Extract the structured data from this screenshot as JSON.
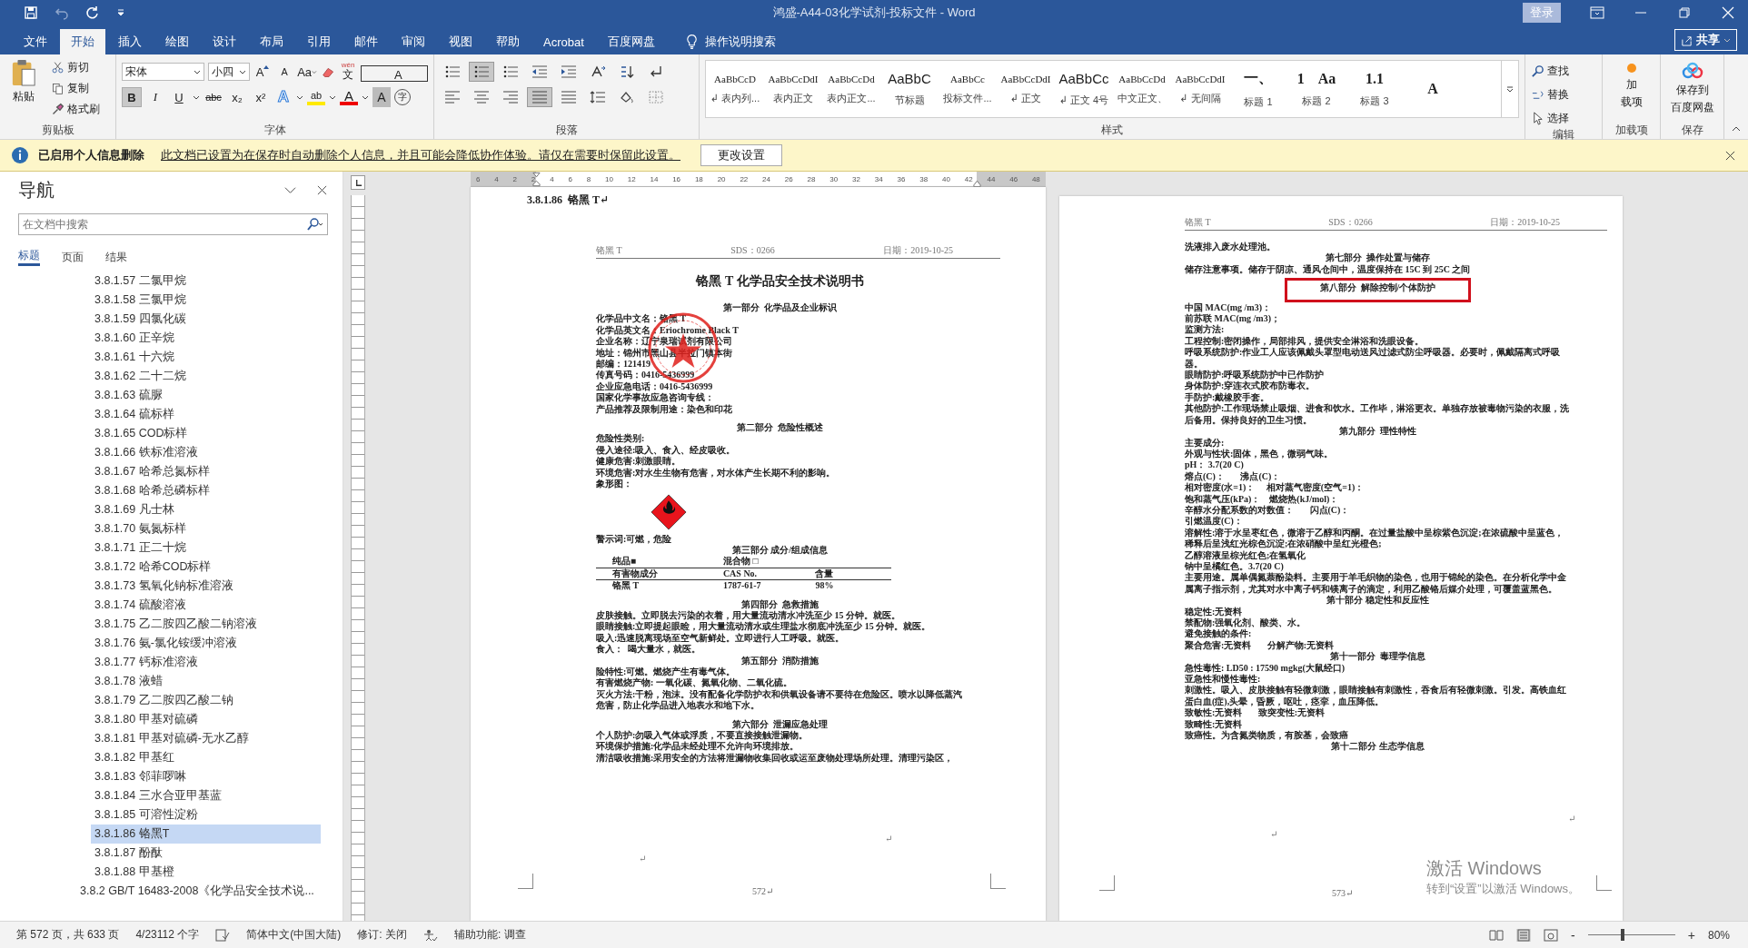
{
  "window": {
    "title": "鸿盛-A44-03化学试剂-投标文件  -  Word",
    "sign_in": "登录"
  },
  "tabs": [
    {
      "label": "文件",
      "selected": false
    },
    {
      "label": "开始",
      "selected": true
    },
    {
      "label": "插入",
      "selected": false
    },
    {
      "label": "绘图",
      "selected": false
    },
    {
      "label": "设计",
      "selected": false
    },
    {
      "label": "布局",
      "selected": false
    },
    {
      "label": "引用",
      "selected": false
    },
    {
      "label": "邮件",
      "selected": false
    },
    {
      "label": "审阅",
      "selected": false
    },
    {
      "label": "视图",
      "selected": false
    },
    {
      "label": "帮助",
      "selected": false
    },
    {
      "label": "Acrobat",
      "selected": false
    },
    {
      "label": "百度网盘",
      "selected": false
    }
  ],
  "tell_me": "操作说明搜索",
  "share": "共享",
  "ribbon": {
    "clipboard": {
      "paste": "粘贴",
      "items": [
        "剪切",
        "复制",
        "格式刷"
      ],
      "label": "剪贴板"
    },
    "font": {
      "name": "宋体",
      "size": "小四",
      "grow": "A",
      "shrink": "A",
      "case": "Aa",
      "ruby": "wén",
      "ruby_base": "文",
      "border_char": "A",
      "row2": [
        {
          "text": "B",
          "selected": true
        },
        {
          "text": "I",
          "selected": false
        },
        {
          "text": "U",
          "selected": false
        },
        {
          "text": "abc",
          "selected": false
        },
        {
          "text": "x₂",
          "selected": false
        },
        {
          "text": "x²",
          "selected": false
        }
      ],
      "effects": "A",
      "highlight": "ab",
      "font_color_char": "A",
      "shading": "A",
      "enclose": "字",
      "label": "字体"
    },
    "paragraph": {
      "row1": [
        {
          "selected": false
        },
        {
          "selected": true
        },
        {
          "selected": false
        },
        {
          "selected": false
        },
        {
          "selected": false
        },
        {
          "selected": false
        },
        {
          "selected": false
        },
        {
          "selected": false
        }
      ],
      "row2": [
        {
          "selected": false
        },
        {
          "selected": false
        },
        {
          "selected": false
        },
        {
          "selected": true
        },
        {
          "selected": false
        },
        {
          "selected": false
        },
        {
          "selected": false
        },
        {
          "selected": false
        }
      ],
      "label": "段落"
    },
    "styles": {
      "items": [
        {
          "preview": "AaBbCcD",
          "label": "↲ 表内列..."
        },
        {
          "preview": "AaBbCcDdI",
          "label": "表内正文"
        },
        {
          "preview": "AaBbCcDd",
          "label": "表内正文..."
        },
        {
          "preview": "AaBbC",
          "label": "节标题"
        },
        {
          "preview": "AaBbCc",
          "label": "投标文件..."
        },
        {
          "preview": "AaBbCcDdI",
          "label": "↲ 正文"
        },
        {
          "preview": "AaBbCc",
          "label": "↲ 正文 4号"
        },
        {
          "preview": "AaBbCcDd",
          "label": "中文正文、"
        },
        {
          "preview": "AaBbCcDdI",
          "label": "↲ 无间隔"
        },
        {
          "preview": "一、",
          "label": "标题 1"
        },
        {
          "preview": "1    Aa",
          "label": "标题 2"
        },
        {
          "preview": "1.1",
          "label": "标题 3"
        },
        {
          "preview": "A"
        }
      ],
      "label": "样式"
    },
    "editing": {
      "items": [
        "查找",
        "替换",
        "选择"
      ],
      "label": "编辑"
    },
    "addins": {
      "button": [
        "加",
        "载项"
      ],
      "label": "加载项"
    },
    "save": {
      "button": [
        "保存到",
        "百度网盘"
      ],
      "label": "保存"
    }
  },
  "info_bar": {
    "title": "已启用个人信息删除",
    "message": "此文档已设置为在保存时自动删除个人信息，并且可能会降低协作体验。请仅在需要时保留此设置。",
    "button": "更改设置"
  },
  "navigation": {
    "title": "导航",
    "search": {
      "placeholder": "在文档中搜索"
    },
    "tabs": [
      {
        "label": "标题",
        "selected": true
      },
      {
        "label": "页面",
        "selected": false
      },
      {
        "label": "结果",
        "selected": false
      }
    ],
    "outline": [
      {
        "children": [
          {
            "label": "3.8.1.57 二氯甲烷",
            "selected": false
          },
          {
            "label": "3.8.1.58 三氯甲烷",
            "selected": false
          },
          {
            "label": "3.8.1.59 四氯化碳",
            "selected": false
          },
          {
            "label": "3.8.1.60 正辛烷",
            "selected": false
          },
          {
            "label": "3.8.1.61 十六烷",
            "selected": false
          },
          {
            "label": "3.8.1.62 二十二烷",
            "selected": false
          },
          {
            "label": "3.8.1.63 硫脲",
            "selected": false
          },
          {
            "label": "3.8.1.64 硫标样",
            "selected": false
          },
          {
            "label": "3.8.1.65 COD标样",
            "selected": false
          },
          {
            "label": "3.8.1.66 铁标准溶液",
            "selected": false
          },
          {
            "label": "3.8.1.67 哈希总氮标样",
            "selected": false
          },
          {
            "label": "3.8.1.68 哈希总磷标样",
            "selected": false
          },
          {
            "label": "3.8.1.69 凡士林",
            "selected": false
          },
          {
            "label": "3.8.1.70 氨氮标样",
            "selected": false
          },
          {
            "label": "3.8.1.71 正二十烷",
            "selected": false
          },
          {
            "label": "3.8.1.72 哈希COD标样",
            "selected": false
          },
          {
            "label": "3.8.1.73 氢氧化钠标准溶液",
            "selected": false
          },
          {
            "label": "3.8.1.74 硫酸溶液",
            "selected": false
          },
          {
            "label": "3.8.1.75 乙二胺四乙酸二钠溶液",
            "selected": false
          },
          {
            "label": "3.8.1.76 氨-氯化铵缓冲溶液",
            "selected": false
          },
          {
            "label": "3.8.1.77 钙标准溶液",
            "selected": false
          },
          {
            "label": "3.8.1.78 液蜡",
            "selected": false
          },
          {
            "label": "3.8.1.79 乙二胺四乙酸二钠",
            "selected": false
          },
          {
            "label": "3.8.1.80 甲基对硫磷",
            "selected": false
          },
          {
            "label": "3.8.1.81 甲基对硫磷-无水乙醇",
            "selected": false
          },
          {
            "label": "3.8.1.82 甲基红",
            "selected": false
          },
          {
            "label": "3.8.1.83 邻菲啰啉",
            "selected": false
          },
          {
            "label": "3.8.1.84 三水合亚甲基蓝",
            "selected": false
          },
          {
            "label": "3.8.1.85 可溶性淀粉",
            "selected": false
          },
          {
            "label": "3.8.1.86 铬黑T",
            "selected": true
          },
          {
            "label": "3.8.1.87 酚酞",
            "selected": false
          },
          {
            "label": "3.8.1.88 甲基橙",
            "selected": false
          }
        ]
      },
      {
        "label": "3.8.2 GB/T 16483-2008《化学品安全技术说...",
        "selected": false
      }
    ]
  },
  "ruler": [
    "6",
    "4",
    "2",
    "2",
    "4",
    "6",
    "8",
    "10",
    "12",
    "14",
    "16",
    "18",
    "20",
    "22",
    "24",
    "26",
    "28",
    "30",
    "32",
    "34",
    "36",
    "38",
    "40",
    "42",
    "44",
    "46",
    "48"
  ],
  "pages": [
    {
      "heading": "3.8.1.86  铬黑 T↵",
      "header": [
        "铬黑 T",
        "SDS：0266",
        "日期：2019-10-25"
      ],
      "title": "铬黑 T 化学品安全技术说明书",
      "lines": [
        {
          "kind": "h",
          "text": "第一部分  化学品及企业标识"
        },
        {
          "kind": "p",
          "text": "化学品中文名：铬黑 T"
        },
        {
          "kind": "p",
          "text": "化学品英文名：Eriochrome Black T"
        },
        {
          "kind": "p",
          "text": "企业名称：辽宁泉瑞试剂有限公司"
        },
        {
          "kind": "p",
          "text": "地址：锦州市黑山县半拉门镇本街"
        },
        {
          "kind": "p",
          "text": "邮编：121419"
        },
        {
          "kind": "p",
          "text": "传真号码：0416-5436999"
        },
        {
          "kind": "p",
          "text": "企业应急电话：0416-5436999"
        },
        {
          "kind": "p",
          "text": "国家化学事故应急咨询专线："
        },
        {
          "kind": "p",
          "text": "产品推荐及限制用途：染色和印花"
        },
        {
          "kind": "gap"
        },
        {
          "kind": "h",
          "text": "第二部分  危险性概述"
        },
        {
          "kind": "p",
          "text": "危险性类别:"
        },
        {
          "kind": "p",
          "text": "侵入途径:吸入、食入、经皮吸收。"
        },
        {
          "kind": "p",
          "text": "健康危害:刺激眼睛。"
        },
        {
          "kind": "p",
          "text": "环境危害:对水生生物有危害，对水体产生长期不利的影响。"
        },
        {
          "kind": "p",
          "text": "象形图："
        },
        {
          "kind": "hazard"
        },
        {
          "kind": "p",
          "text": "警示词:可燃，危险"
        },
        {
          "kind": "h",
          "text": "第三部分 成分/组成信息"
        },
        {
          "kind": "table",
          "rows": [
            [
              "纯品■",
              "混合物 □"
            ],
            [
              "有害物成分",
              "CAS  No.",
              "含量"
            ],
            [
              "铬黑 T",
              "1787-61-7",
              "98%"
            ]
          ]
        },
        {
          "kind": "gap"
        },
        {
          "kind": "h",
          "text": "第四部分  急救措施"
        },
        {
          "kind": "p",
          "text": "皮肤接触。立即脱去污染的衣着，用大量流动清水冲洗至少 15 分钟。就医。"
        },
        {
          "kind": "p",
          "text": "眼睛接触:立即提起眼睑，用大量流动清水或生理盐水彻底冲洗至少 15 分钟。就医。"
        },
        {
          "kind": "p",
          "text": "吸入:迅速脱离现场至空气新鲜处。立即进行人工呼吸。就医。"
        },
        {
          "kind": "p",
          "text": "食入：  喝大量水，就医。"
        },
        {
          "kind": "h",
          "text": "第五部分  消防措施"
        },
        {
          "kind": "p",
          "text": "险特性:可燃。燃烧产生有毒气体。"
        },
        {
          "kind": "p",
          "text": "有害燃烧产物: 一氧化碳、氮氧化物、二氧化硫。"
        },
        {
          "kind": "p",
          "text": "灭火方法:干粉，泡沫。没有配备化学防护衣和供氧设备请不要待在危险区。喷水以降低蒸汽危害，防止化学品进入地表水和地下水。"
        },
        {
          "kind": "gap"
        },
        {
          "kind": "h",
          "text": "第六部分  泄漏应急处理"
        },
        {
          "kind": "p",
          "text": "个人防护:勿吸入气体或浮质，不要直接接触泄漏物。"
        },
        {
          "kind": "p",
          "text": "环境保护措施:化学品未经处理不允许向环境排放。"
        },
        {
          "kind": "p",
          "text": "清洁吸收措施:采用安全的方法将泄漏物收集回收或运至废物处理场所处理。清理污染区，"
        }
      ],
      "marks": [
        "↵",
        "↵"
      ],
      "page_number": "572↵"
    },
    {
      "header": [
        "铬黑 T",
        "SDS：0266",
        "日期：2019-10-25"
      ],
      "lines": [
        {
          "kind": "p",
          "text": "洗液排入废水处理池。"
        },
        {
          "kind": "h",
          "text": "第七部分  操作处置与储存"
        },
        {
          "kind": "p",
          "text": "储存注意事项。储存于阴凉、通风仓间中，温度保持在 15C 到 25C 之间"
        },
        {
          "kind": "boxed",
          "text": "第八部分  解除控制/个体防护"
        },
        {
          "kind": "p",
          "text": "中国 MAC(mg /m3)："
        },
        {
          "kind": "p",
          "text": "前苏联 MAC(mg /m3)；"
        },
        {
          "kind": "p",
          "text": "监测方法:"
        },
        {
          "kind": "p",
          "text": "工程控制:密闭操作，局部排风，提供安全淋浴和洗眼设备。"
        },
        {
          "kind": "p",
          "text": "呼吸系统防护:作业工人应该佩戴头罩型电动送风过滤式防尘呼吸器。必要时，佩戴隔离式呼吸器。"
        },
        {
          "kind": "p",
          "text": "眼睛防护:呼吸系统防护中已作防护"
        },
        {
          "kind": "p",
          "text": "身体防护:穿连衣式胶布防毒衣。"
        },
        {
          "kind": "p",
          "text": "手防护:戴橡胶手套。"
        },
        {
          "kind": "p",
          "text": "其他防护:工作现场禁止吸烟、进食和饮水。工作毕，淋浴更衣。单独存放被毒物污染的衣服，洗后备用。保持良好的卫生习惯。"
        },
        {
          "kind": "h",
          "text": "第九部分  理性特性"
        },
        {
          "kind": "p",
          "text": "主要成分:"
        },
        {
          "kind": "p",
          "text": "外观与性状:固体，黑色，微弱气味。"
        },
        {
          "kind": "p",
          "text": "pH： 3.7(20 C)"
        },
        {
          "kind": "p",
          "text": "熔点(C)：       沸点(C)："
        },
        {
          "kind": "p",
          "text": "相对密度(水=1)：     相对蒸气密度(空气=1)："
        },
        {
          "kind": "p",
          "text": "饱和蒸气压(kPa)：    燃烧热(kJ/mol)："
        },
        {
          "kind": "p",
          "text": "辛醇水分配系数的对数值：       闪点(C)："
        },
        {
          "kind": "p",
          "text": "引燃温度(C)："
        },
        {
          "kind": "p",
          "text": "溶解性:溶于水呈枣红色，微溶于乙醇和丙酮。在过量盐酸中呈棕紫色沉淀;在浓硫酸中呈蓝色，稀释后呈浅红光棕色沉淀;在浓硝酸中呈红光橙色;"
        },
        {
          "kind": "p",
          "text": "乙醇溶液呈棕光红色;在氢氧化"
        },
        {
          "kind": "p",
          "text": "钠中呈橘红色。3.7(20 C)"
        },
        {
          "kind": "p",
          "text": "主要用途。属单偶氮萘酚染料。主要用于羊毛织物的染色，也用于锦纶的染色。在分析化学中金属离子指示剂，尤其对水中离子钙和镁离子的滴定，利用乙酸铬后媒介处理，可覆盖蓝黑色。"
        },
        {
          "kind": "h",
          "text": "第十部分 稳定性和反应性"
        },
        {
          "kind": "p",
          "text": "稳定性:无资料"
        },
        {
          "kind": "p",
          "text": "禁配物:强氧化剂、酸类、水。"
        },
        {
          "kind": "p",
          "text": "避免接触的条件:"
        },
        {
          "kind": "p",
          "text": "聚合危害:无资料       分解产物:无资料"
        },
        {
          "kind": "h",
          "text": "第十一部分  毒理学信息"
        },
        {
          "kind": "p",
          "text": "急性毒性: LD50 : 17590 mgkg(大鼠经口)"
        },
        {
          "kind": "p",
          "text": "亚急性和慢性毒性:"
        },
        {
          "kind": "p",
          "text": "刺激性。吸入、皮肤接触有轻微刺激，眼睛接触有刺激性，吞食后有轻微刺激。引发。高铁血红蛋白血(症),头晕，昏厥，呕吐，痉挛，血压降低。"
        },
        {
          "kind": "p",
          "text": "致敏性:无资料       致突变性:无资料"
        },
        {
          "kind": "p",
          "text": "致畸性:无资料"
        },
        {
          "kind": "p",
          "text": "致癌性。为含氮类物质，有胺基，会致癌"
        },
        {
          "kind": "h",
          "text": "第十二部分 生态学信息"
        }
      ],
      "marks": [
        "↵",
        "↵"
      ],
      "page_number": "573↵"
    }
  ],
  "activation": {
    "title": "激活 Windows",
    "hint": "转到“设置”以激活 Windows。"
  },
  "status_bar": {
    "page": "第 572 页，共 633 页",
    "words": "4/23112 个字",
    "language": "简体中文(中国大陆)",
    "track": "修订: 关闭",
    "accessibility": "辅助功能: 调查",
    "zoom": {
      "minus": "-",
      "plus": "+",
      "level": 0.4,
      "reading": "80%"
    }
  }
}
